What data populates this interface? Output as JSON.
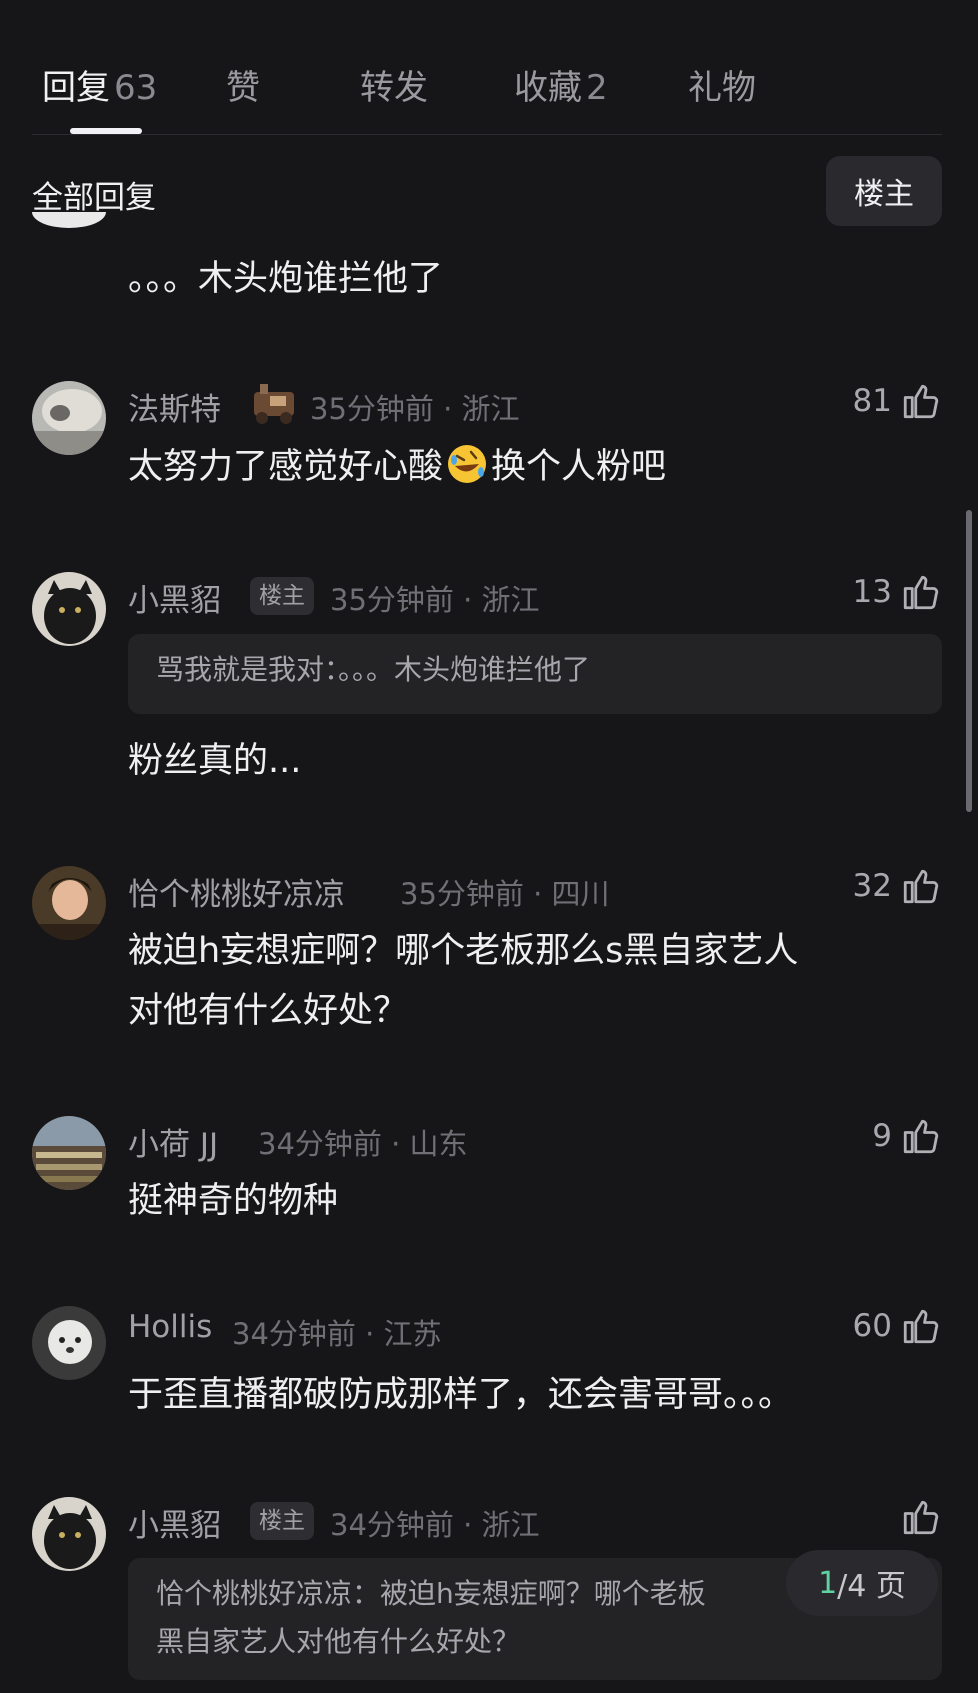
{
  "tabs": [
    {
      "label": "回复",
      "count": "63"
    },
    {
      "label": "赞",
      "count": ""
    },
    {
      "label": "转发",
      "count": ""
    },
    {
      "label": "收藏",
      "count": "2"
    },
    {
      "label": "礼物",
      "count": ""
    }
  ],
  "section": {
    "title": "全部回复",
    "filter_label": "楼主"
  },
  "comments": [
    {
      "content": "。。。木头炮谁拦他了"
    },
    {
      "username": "法斯特",
      "meta": "35分钟前 · 浙江",
      "likes": "81",
      "content_a": "太努力了感觉好心酸",
      "content_b": "换个人粉吧",
      "emoji": "rolling-on-floor-laughing-emoji"
    },
    {
      "username": "小黑貂",
      "badge": "楼主",
      "meta": "35分钟前 · 浙江",
      "likes": "13",
      "quote": "骂我就是我对：。。。木头炮谁拦他了",
      "content": "粉丝真的..."
    },
    {
      "username": "恰个桃桃好凉凉",
      "meta": "35分钟前 · 四川",
      "likes": "32",
      "content_l1": "被迫h妄想症啊？哪个老板那么s黑自家艺人",
      "content_l2": "对他有什么好处？"
    },
    {
      "username": "小荷 JJ",
      "meta": "34分钟前 · 山东",
      "likes": "9",
      "content": "挺神奇的物种"
    },
    {
      "username": "Hollis",
      "meta": "34分钟前 · 江苏",
      "likes": "60",
      "content": "于歪直播都破防成那样了，还会害哥哥。。。"
    },
    {
      "username": "小黑貂",
      "badge": "楼主",
      "meta": "34分钟前 · 浙江",
      "likes": "",
      "quote_l1": "恰个桃桃好凉凉：被迫h妄想症啊？哪个老板",
      "quote_l2": "黑自家艺人对他有什么好处？"
    }
  ],
  "pager": {
    "current": "1",
    "total": "/4 页"
  }
}
